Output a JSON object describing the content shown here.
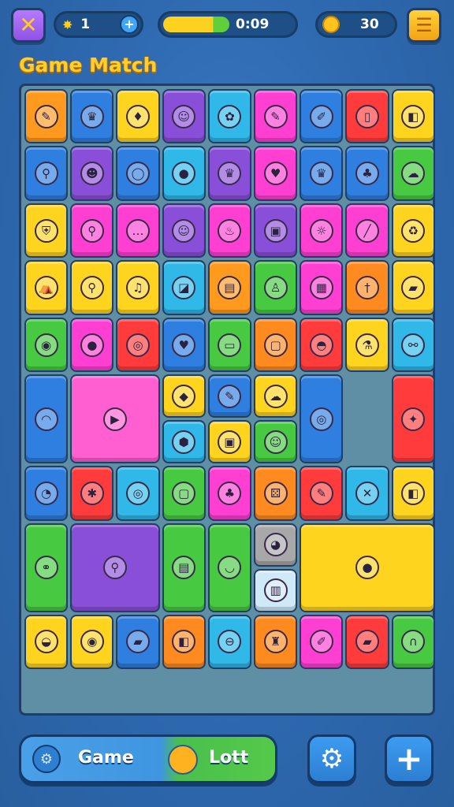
{
  "header": {
    "lives": "1",
    "timer": "0:09",
    "coins": "30",
    "progress": 0.7
  },
  "title": "Game Match",
  "footer": {
    "left_label": "Game",
    "right_label": "Lott"
  },
  "icons": {
    "close": "close-icon",
    "add": "plus-icon",
    "coin": "coin-icon",
    "menu": "menu-icon",
    "settings": "gear-icon",
    "add_button": "plus-icon"
  },
  "palette": {
    "board_bg": "#5f8fa4",
    "tiles": [
      "#ffd41f",
      "#2f7fe0",
      "#ff3fd2",
      "#47c941",
      "#ff8a1f",
      "#ff3b3b",
      "#8a4fd8",
      "#2fb8e8"
    ]
  },
  "tiles": [
    {
      "name": "pencil",
      "c": "#ff9a1f",
      "g": "✎"
    },
    {
      "name": "crown",
      "c": "#2f7fe0",
      "g": "♛"
    },
    {
      "name": "leaf",
      "c": "#ffd41f",
      "g": "♦"
    },
    {
      "name": "monster",
      "c": "#8a4fd8",
      "g": "☺"
    },
    {
      "name": "bug",
      "c": "#2fb8e8",
      "g": "✿"
    },
    {
      "name": "pen",
      "c": "#ff3fd2",
      "g": "✎"
    },
    {
      "name": "brush",
      "c": "#2f7fe0",
      "g": "✐"
    },
    {
      "name": "phone",
      "c": "#ff3b3b",
      "g": "▯"
    },
    {
      "name": "box",
      "c": "#ffd41f",
      "g": "◧"
    },
    {
      "name": "key",
      "c": "#2f7fe0",
      "g": "⚲"
    },
    {
      "name": "cat",
      "c": "#8a4fd8",
      "g": "☻"
    },
    {
      "name": "ring",
      "c": "#2f7fe0",
      "g": "◯"
    },
    {
      "name": "ball",
      "c": "#2fb8e8",
      "g": "●"
    },
    {
      "name": "crown",
      "c": "#8a4fd8",
      "g": "♛"
    },
    {
      "name": "heart",
      "c": "#ff3fd2",
      "g": "♥"
    },
    {
      "name": "crown",
      "c": "#2f7fe0",
      "g": "♛"
    },
    {
      "name": "leaf",
      "c": "#2f7fe0",
      "g": "♣"
    },
    {
      "name": "ghost",
      "c": "#47c941",
      "g": "☁"
    },
    {
      "name": "shield",
      "c": "#ffd41f",
      "g": "⛨"
    },
    {
      "name": "pin",
      "c": "#ff3fd2",
      "g": "⚲"
    },
    {
      "name": "chat",
      "c": "#ff3fd2",
      "g": "…"
    },
    {
      "name": "alien",
      "c": "#8a4fd8",
      "g": "☺"
    },
    {
      "name": "cup",
      "c": "#ff3fd2",
      "g": "♨"
    },
    {
      "name": "robot",
      "c": "#8a4fd8",
      "g": "▣"
    },
    {
      "name": "sun",
      "c": "#ff3fd2",
      "g": "☼"
    },
    {
      "name": "wand",
      "c": "#ff3fd2",
      "g": "╱"
    },
    {
      "name": "bin",
      "c": "#ffd41f",
      "g": "♻"
    },
    {
      "name": "tent",
      "c": "#ffd41f",
      "g": "⛺"
    },
    {
      "name": "pin",
      "c": "#ffd41f",
      "g": "⚲"
    },
    {
      "name": "bell",
      "c": "#ffd41f",
      "g": "♫"
    },
    {
      "name": "cube",
      "c": "#2fb8e8",
      "g": "◪"
    },
    {
      "name": "cart",
      "c": "#ff9a1f",
      "g": "▤"
    },
    {
      "name": "figure",
      "c": "#47c941",
      "g": "♙"
    },
    {
      "name": "rubik",
      "c": "#ff3fd2",
      "g": "▦"
    },
    {
      "name": "blade",
      "c": "#ff8a1f",
      "g": "†"
    },
    {
      "name": "eraser",
      "c": "#ffd41f",
      "g": "▰"
    },
    {
      "name": "blob",
      "c": "#47c941",
      "g": "◉"
    },
    {
      "name": "lolly",
      "c": "#ff3fd2",
      "g": "●"
    },
    {
      "name": "lens",
      "c": "#ff3b3b",
      "g": "◎"
    },
    {
      "name": "apple",
      "c": "#2f7fe0",
      "g": "♥"
    },
    {
      "name": "battery",
      "c": "#47c941",
      "g": "▭"
    },
    {
      "name": "bag",
      "c": "#ff8a1f",
      "g": "▢"
    },
    {
      "name": "burger",
      "c": "#ff3b3b",
      "g": "◓"
    },
    {
      "name": "potion",
      "c": "#ffd41f",
      "g": "⚗"
    },
    {
      "name": "bone",
      "c": "#2fb8e8",
      "g": "⚯"
    },
    {
      "name": "rainbow",
      "c": "#2f7fe0",
      "g": "◠"
    },
    {
      "name": "play",
      "c": "#ff5fd0",
      "g": "▶"
    },
    {
      "name": "gem",
      "c": "#ffd41f",
      "g": "◆"
    },
    {
      "name": "brush",
      "c": "#2f7fe0",
      "g": "✎"
    },
    {
      "name": "cloud",
      "c": "#ffd41f",
      "g": "☁"
    },
    {
      "name": "goggles",
      "c": "#2f7fe0",
      "g": "◎"
    },
    {
      "name": "bird",
      "c": "#ff3b3b",
      "g": "✦"
    },
    {
      "name": "hexagon",
      "c": "#2fb8e8",
      "g": "⬢"
    },
    {
      "name": "frame",
      "c": "#ffd41f",
      "g": "▣"
    },
    {
      "name": "face",
      "c": "#47c941",
      "g": "☺"
    },
    {
      "name": "pie",
      "c": "#2f7fe0",
      "g": "◔"
    },
    {
      "name": "fan",
      "c": "#ff3b3b",
      "g": "✱"
    },
    {
      "name": "donut",
      "c": "#2fb8e8",
      "g": "◎"
    },
    {
      "name": "bag",
      "c": "#47c941",
      "g": "▢"
    },
    {
      "name": "plant",
      "c": "#ff3fd2",
      "g": "♣"
    },
    {
      "name": "dice",
      "c": "#ff8a1f",
      "g": "⚄"
    },
    {
      "name": "pencil",
      "c": "#ff3b3b",
      "g": "✎"
    },
    {
      "name": "rune",
      "c": "#2fb8e8",
      "g": "✕"
    },
    {
      "name": "bag",
      "c": "#ffd41f",
      "g": "◧"
    },
    {
      "name": "usb",
      "c": "#47c941",
      "g": "⚭"
    },
    {
      "name": "key",
      "c": "#8a4fd8",
      "g": "⚲"
    },
    {
      "name": "shelf",
      "c": "#47c941",
      "g": "▤"
    },
    {
      "name": "bowl",
      "c": "#47c941",
      "g": "◡"
    },
    {
      "name": "bulb",
      "c": "#a8a8a8",
      "g": "◕"
    },
    {
      "name": "book",
      "c": "#cfe9f8",
      "g": "▥"
    },
    {
      "name": "apple",
      "c": "#ffd41f",
      "g": "●"
    },
    {
      "name": "pot",
      "c": "#ffd41f",
      "g": "◒"
    },
    {
      "name": "lollipop",
      "c": "#ffd41f",
      "g": "◉"
    },
    {
      "name": "eraser",
      "c": "#2f7fe0",
      "g": "▰"
    },
    {
      "name": "box",
      "c": "#ff8a1f",
      "g": "◧"
    },
    {
      "name": "bandage",
      "c": "#2fb8e8",
      "g": "⊖"
    },
    {
      "name": "stool",
      "c": "#ff8a1f",
      "g": "♜"
    },
    {
      "name": "pen",
      "c": "#ff3fd2",
      "g": "✐"
    },
    {
      "name": "gum",
      "c": "#ff3b3b",
      "g": "▰"
    },
    {
      "name": "magnet",
      "c": "#47c941",
      "g": "∩"
    },
    {
      "name": "books",
      "c": "#47c941",
      "g": "▤"
    },
    {
      "name": "medal",
      "c": "#8a4fd8",
      "g": "✪"
    },
    {
      "name": "tv",
      "c": "#ff3fd2",
      "g": "▣"
    },
    {
      "name": "ring",
      "c": "#ff3fd2",
      "g": "◯"
    },
    {
      "name": "chick",
      "c": "#ff3fd2",
      "g": "☻"
    },
    {
      "name": "star",
      "c": "#ff3fd2",
      "g": "★"
    },
    {
      "name": "virus",
      "c": "#8a4fd8",
      "g": "✺"
    },
    {
      "name": "balloon",
      "c": "#47c941",
      "g": "◉"
    },
    {
      "name": "pencil",
      "c": "#ffd41f",
      "g": "✎"
    },
    {
      "name": "pipe",
      "c": "#ff8a1f",
      "g": "◎"
    },
    {
      "name": "cube",
      "c": "#47c941",
      "g": "◪"
    }
  ]
}
